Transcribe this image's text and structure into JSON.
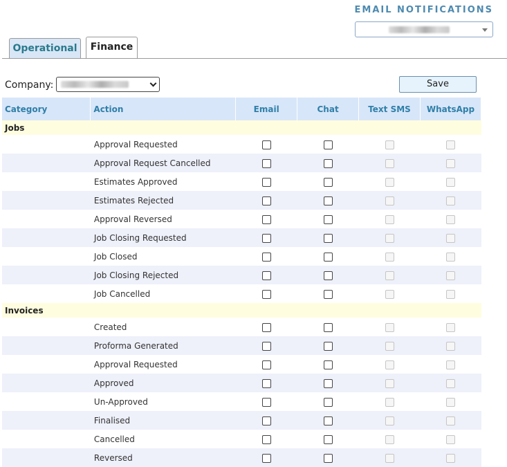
{
  "header": {
    "title": "EMAIL NOTIFICATIONS"
  },
  "tabs": [
    {
      "label": "Operational",
      "active": false
    },
    {
      "label": "Finance",
      "active": true
    }
  ],
  "filters": {
    "company_label": "Company:"
  },
  "toolbar": {
    "save_label": "Save"
  },
  "table": {
    "columns": [
      "Category",
      "Action",
      "Email",
      "Chat",
      "Text SMS",
      "WhatsApp"
    ],
    "groups": [
      {
        "category": "Jobs",
        "actions": [
          "Approval Requested",
          "Approval Request Cancelled",
          "Estimates Approved",
          "Estimates Rejected",
          "Approval Reversed",
          "Job Closing Requested",
          "Job Closed",
          "Job Closing Rejected",
          "Job Cancelled"
        ]
      },
      {
        "category": "Invoices",
        "actions": [
          "Created",
          "Proforma Generated",
          "Approval Requested",
          "Approved",
          "Un-Approved",
          "Finalised",
          "Cancelled",
          "Reversed"
        ]
      }
    ]
  },
  "colors": {
    "accent": "#4d8ab0",
    "header_bg": "#d8e6f9",
    "category_bg": "#fffde0",
    "alt_row_bg": "#eef0fa"
  }
}
